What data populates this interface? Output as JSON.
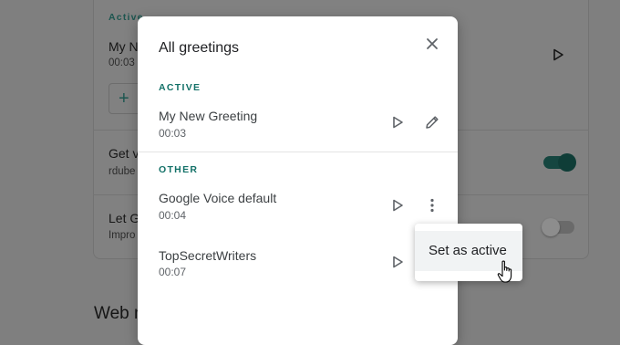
{
  "background_page": {
    "section_label": "Active",
    "active_greeting_title": "My N",
    "active_greeting_duration": "00:03",
    "add_button_icon": "plus-icon",
    "setting1_title": "Get v",
    "setting1_sub": "rdube",
    "setting2_title": "Let G",
    "setting2_sub": "Impro",
    "footer_section": "Web n"
  },
  "dialog": {
    "title": "All greetings",
    "close_icon": "close-icon",
    "active_label": "ACTIVE",
    "other_label": "OTHER",
    "active_greeting": {
      "title": "My New Greeting",
      "duration": "00:03"
    },
    "other_greetings": [
      {
        "title": "Google Voice default",
        "duration": "00:04"
      },
      {
        "title": "TopSecretWriters",
        "duration": "00:07"
      }
    ]
  },
  "menu": {
    "items": [
      {
        "label": "Set as active"
      }
    ]
  },
  "colors": {
    "accent": "#137168",
    "scrim": "#7f7f7f",
    "dialog_bg": "#ffffff"
  }
}
